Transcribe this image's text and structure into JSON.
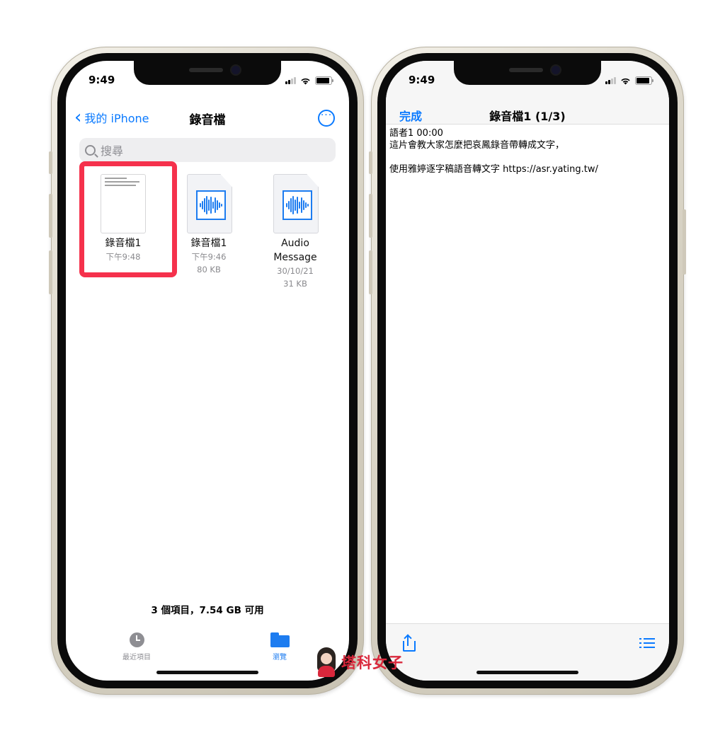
{
  "left_phone": {
    "status_time": "9:49",
    "nav": {
      "back_label": "我的 iPhone",
      "title": "錄音檔"
    },
    "search": {
      "placeholder": "搜尋"
    },
    "files": [
      {
        "name": "錄音檔1",
        "meta1": "下午9:48",
        "meta2": "",
        "kind": "document"
      },
      {
        "name": "錄音檔1",
        "meta1": "下午9:46",
        "meta2": "80 KB",
        "kind": "audio"
      },
      {
        "name_line1": "Audio",
        "name_line2": "Message",
        "meta1": "30/10/21",
        "meta2": "31 KB",
        "kind": "audio"
      }
    ],
    "footer_count": "3 個項目，7.54 GB 可用",
    "tabs": [
      {
        "label": "最近項目",
        "icon": "clock-icon",
        "selected": false
      },
      {
        "label": "瀏覽",
        "icon": "folder-icon",
        "selected": true
      }
    ]
  },
  "right_phone": {
    "status_time": "9:49",
    "nav": {
      "done_label": "完成",
      "title": "錄音檔1 (1/3)"
    },
    "document_lines": [
      "語者1 00:00",
      "這片會教大家怎麼把哀鳳錄音帶轉成文字，",
      "",
      "使用雅婷逐字稿語音轉文字 https://asr.yating.tw/"
    ],
    "toolbar": {
      "share_icon": "share-icon",
      "list_icon": "list-icon"
    }
  },
  "watermark": {
    "text": "塔科女子"
  },
  "colors": {
    "accent": "#0a7aff",
    "highlight": "#f5314c",
    "brand": "#d9273b"
  }
}
